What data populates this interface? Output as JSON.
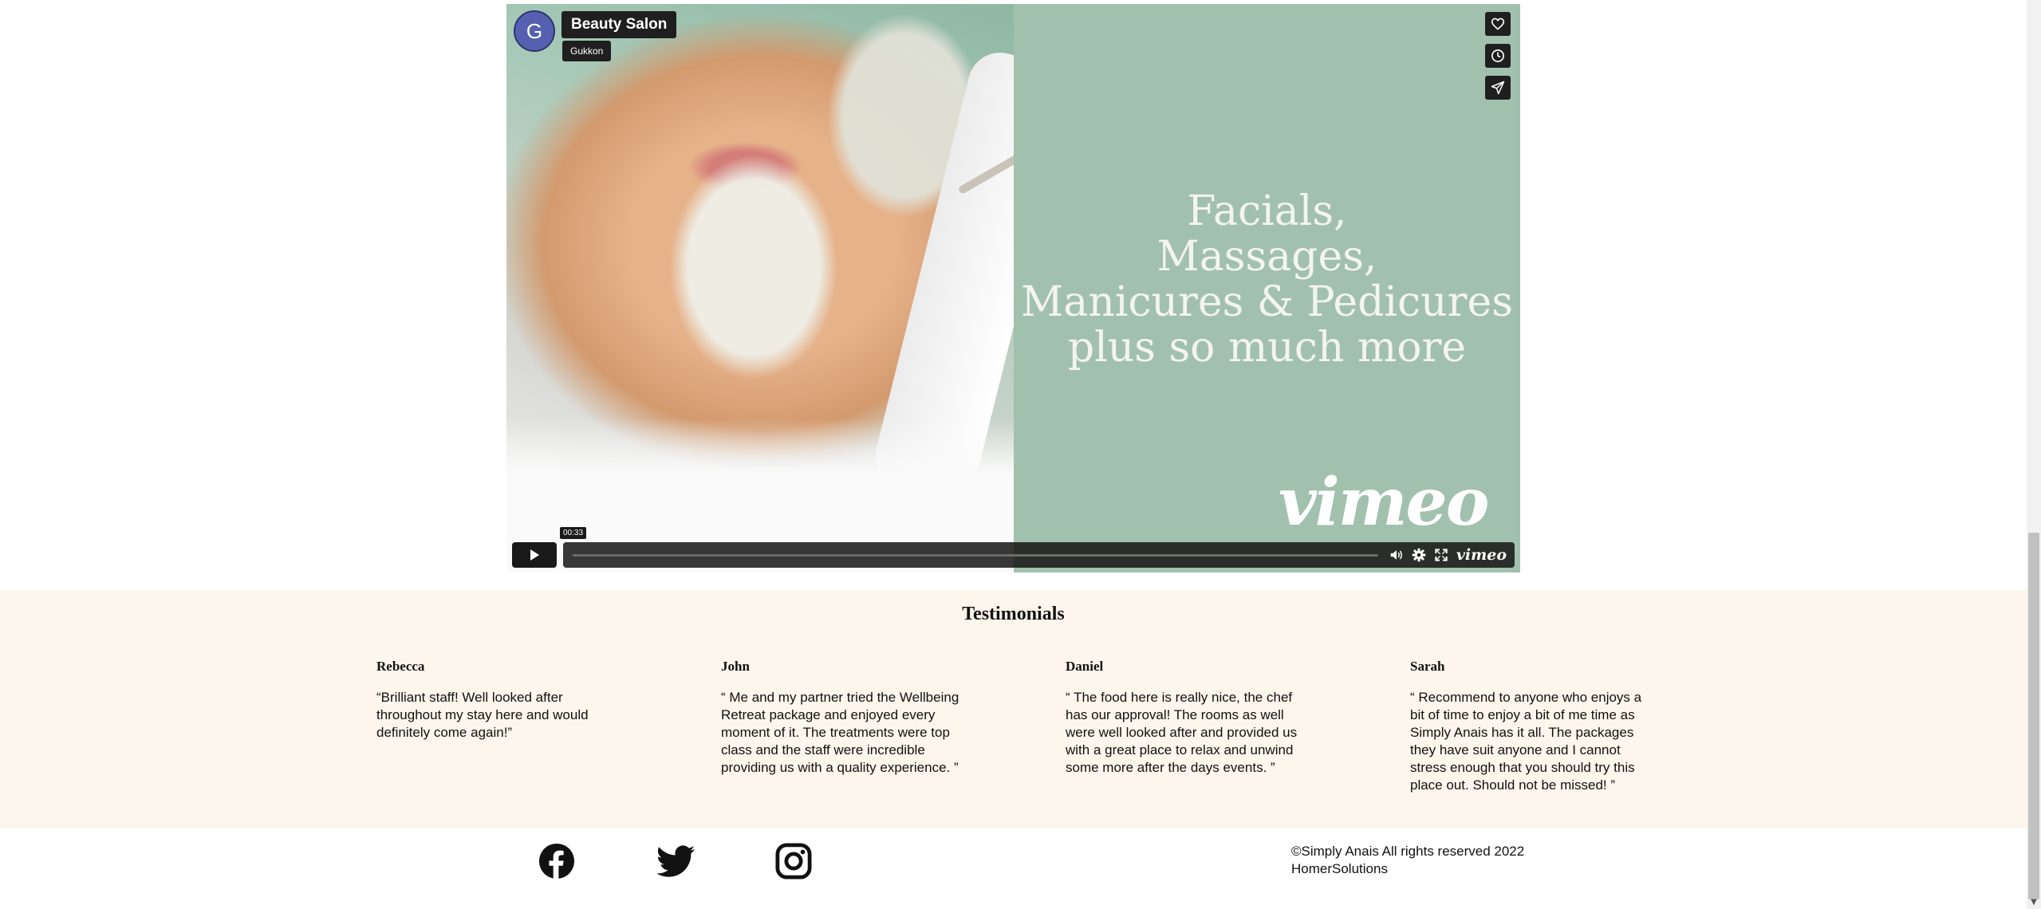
{
  "video": {
    "title": "Beauty Salon",
    "owner": "Gukkon",
    "avatar_letter": "G",
    "headline": [
      "Facials,",
      "Massages,",
      "Manicures & Pedicures",
      "plus so much more"
    ],
    "watermark": "vimeo",
    "duration_label": "00:33",
    "progress": 0,
    "side_buttons": [
      "heart-icon",
      "clock-icon",
      "share-icon"
    ],
    "control_icons": [
      "play-icon",
      "volume-icon",
      "settings-gear-icon",
      "fullscreen-icon"
    ],
    "control_brand": "vimeo"
  },
  "testimonials": {
    "heading": "Testimonials",
    "items": [
      {
        "name": "Rebecca",
        "text": "“Brilliant staff! Well looked after throughout my stay here and would definitely come again!”"
      },
      {
        "name": "John",
        "text": "“ Me and my partner tried the Wellbeing Retreat package and enjoyed every moment of it. The treatments were top class and the staff were incredible providing us with a quality experience. ”"
      },
      {
        "name": "Daniel",
        "text": "“ The food here is really nice, the chef has our approval! The rooms as well were well looked after and provided us with a great place to relax and unwind some more after the days events. ”"
      },
      {
        "name": "Sarah",
        "text": "“ Recommend to anyone who enjoys a bit of time to enjoy a bit of me time as Simply Anais has it all. The packages they have suit anyone and I cannot stress enough that you should try this place out. Should not be missed! ”"
      }
    ]
  },
  "footer": {
    "social": [
      "facebook-icon",
      "twitter-icon",
      "instagram-icon"
    ],
    "copyright": "©Simply Anais All rights reserved 2022",
    "credit": "HomerSolutions"
  },
  "colors": {
    "panel_green": "#a1c1ae",
    "testimonial_bg": "#fdf6ec",
    "avatar_blue": "#5561b0"
  }
}
